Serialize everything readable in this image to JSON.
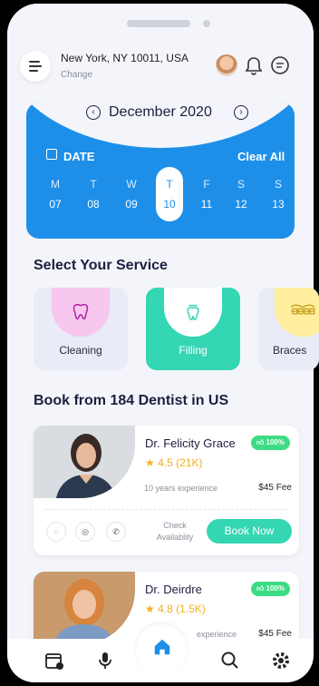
{
  "header": {
    "location": "New York, NY 10011, USA",
    "change_label": "Change"
  },
  "calendar": {
    "month": "December 2020",
    "date_label": "DATE",
    "clear_label": "Clear All",
    "days": [
      {
        "letter": "M",
        "number": "07",
        "selected": false
      },
      {
        "letter": "T",
        "number": "08",
        "selected": false
      },
      {
        "letter": "W",
        "number": "09",
        "selected": false
      },
      {
        "letter": "T",
        "number": "10",
        "selected": true
      },
      {
        "letter": "F",
        "number": "11",
        "selected": false
      },
      {
        "letter": "S",
        "number": "12",
        "selected": false
      },
      {
        "letter": "S",
        "number": "13",
        "selected": false
      }
    ]
  },
  "services": {
    "title": "Select Your Service",
    "items": [
      {
        "label": "Cleaning",
        "icon": "tooth-icon",
        "color": "#f7c7f0"
      },
      {
        "label": "Filling",
        "icon": "tooth-filling-icon",
        "color": "#ffffff"
      },
      {
        "label": "Braces",
        "icon": "braces-icon",
        "color": "#ffef9e"
      }
    ]
  },
  "dentists": {
    "title": "Book from 184 Dentist in US",
    "cards": [
      {
        "name": "Dr. Felicity Grace",
        "badge": "100%",
        "rating": "4.5 (21K)",
        "experience": "10 years experience",
        "fee": "$45 Fee",
        "check_label": "Check Availablity",
        "book_label": "Book Now"
      },
      {
        "name": "Dr. Deirdre",
        "badge": "100%",
        "rating": "4.8 (1.5K)",
        "experience": "experience",
        "fee": "$45 Fee"
      }
    ]
  },
  "colors": {
    "primary": "#1d8fe9",
    "accent": "#34d6b3",
    "badge": "#3ddc84"
  }
}
